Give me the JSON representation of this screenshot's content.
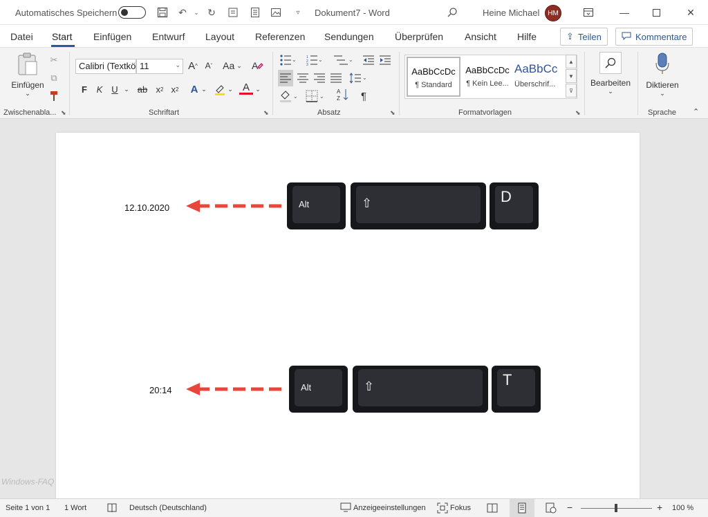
{
  "titlebar": {
    "autosave_label": "Automatisches Speichern",
    "document_title": "Dokument7  -  Word",
    "user_name": "Heine Michael",
    "user_initials": "HM",
    "icons": [
      "save-icon",
      "undo-icon",
      "redo-icon",
      "form-icon",
      "print-preview-icon",
      "image-icon",
      "customize-icon",
      "search-icon",
      "ribbon-display-icon",
      "minimize-icon",
      "maximize-icon",
      "close-icon"
    ]
  },
  "tabs": {
    "items": [
      "Datei",
      "Start",
      "Einfügen",
      "Entwurf",
      "Layout",
      "Referenzen",
      "Sendungen",
      "Überprüfen",
      "Ansicht",
      "Hilfe"
    ],
    "share_label": "Teilen",
    "comments_label": "Kommentare"
  },
  "ribbon": {
    "clipboard": {
      "paste_label": "Einfügen",
      "group_label": "Zwischenablа..."
    },
    "font": {
      "font_name": "Calibri (Textkö",
      "font_size": "11",
      "grow_label": "A",
      "shrink_label": "A",
      "case_label": "Aa",
      "bold": "F",
      "italic": "K",
      "underline": "U",
      "strike": "ab",
      "subscript": "x",
      "superscript": "x",
      "effects": "A",
      "font_color": "A",
      "group_label": "Schriftart"
    },
    "paragraph": {
      "group_label": "Absatz",
      "pilcrow": "¶"
    },
    "styles": {
      "items": [
        {
          "preview": "AaBbCcDc",
          "name": "¶ Standard"
        },
        {
          "preview": "AaBbCcDc",
          "name": "¶ Kein Lee..."
        },
        {
          "preview": "AaBbCc",
          "name": "Überschrif..."
        }
      ],
      "group_label": "Formatvorlagen"
    },
    "editing": {
      "label": "Bearbeiten"
    },
    "voice": {
      "label": "Diktieren",
      "group_label": "Sprache"
    }
  },
  "document": {
    "date_text": "12.10.2020",
    "time_text": "20:14",
    "shortcut1": {
      "key1": "Alt",
      "key2": "⇧",
      "key3": "D"
    },
    "shortcut2": {
      "key1": "Alt",
      "key2": "⇧",
      "key3": "T"
    },
    "arrow_color": "#e8453c"
  },
  "watermark": "Windows-FAQ",
  "statusbar": {
    "page_info": "Seite 1 von 1",
    "word_count": "1 Wort",
    "language": "Deutsch (Deutschland)",
    "display_settings": "Anzeigeeinstellungen",
    "focus": "Fokus",
    "zoom_level": "100 %",
    "zoom_minus": "−",
    "zoom_plus": "+"
  },
  "colors": {
    "accent": "#2b579a",
    "avatar": "#8e2d24"
  }
}
